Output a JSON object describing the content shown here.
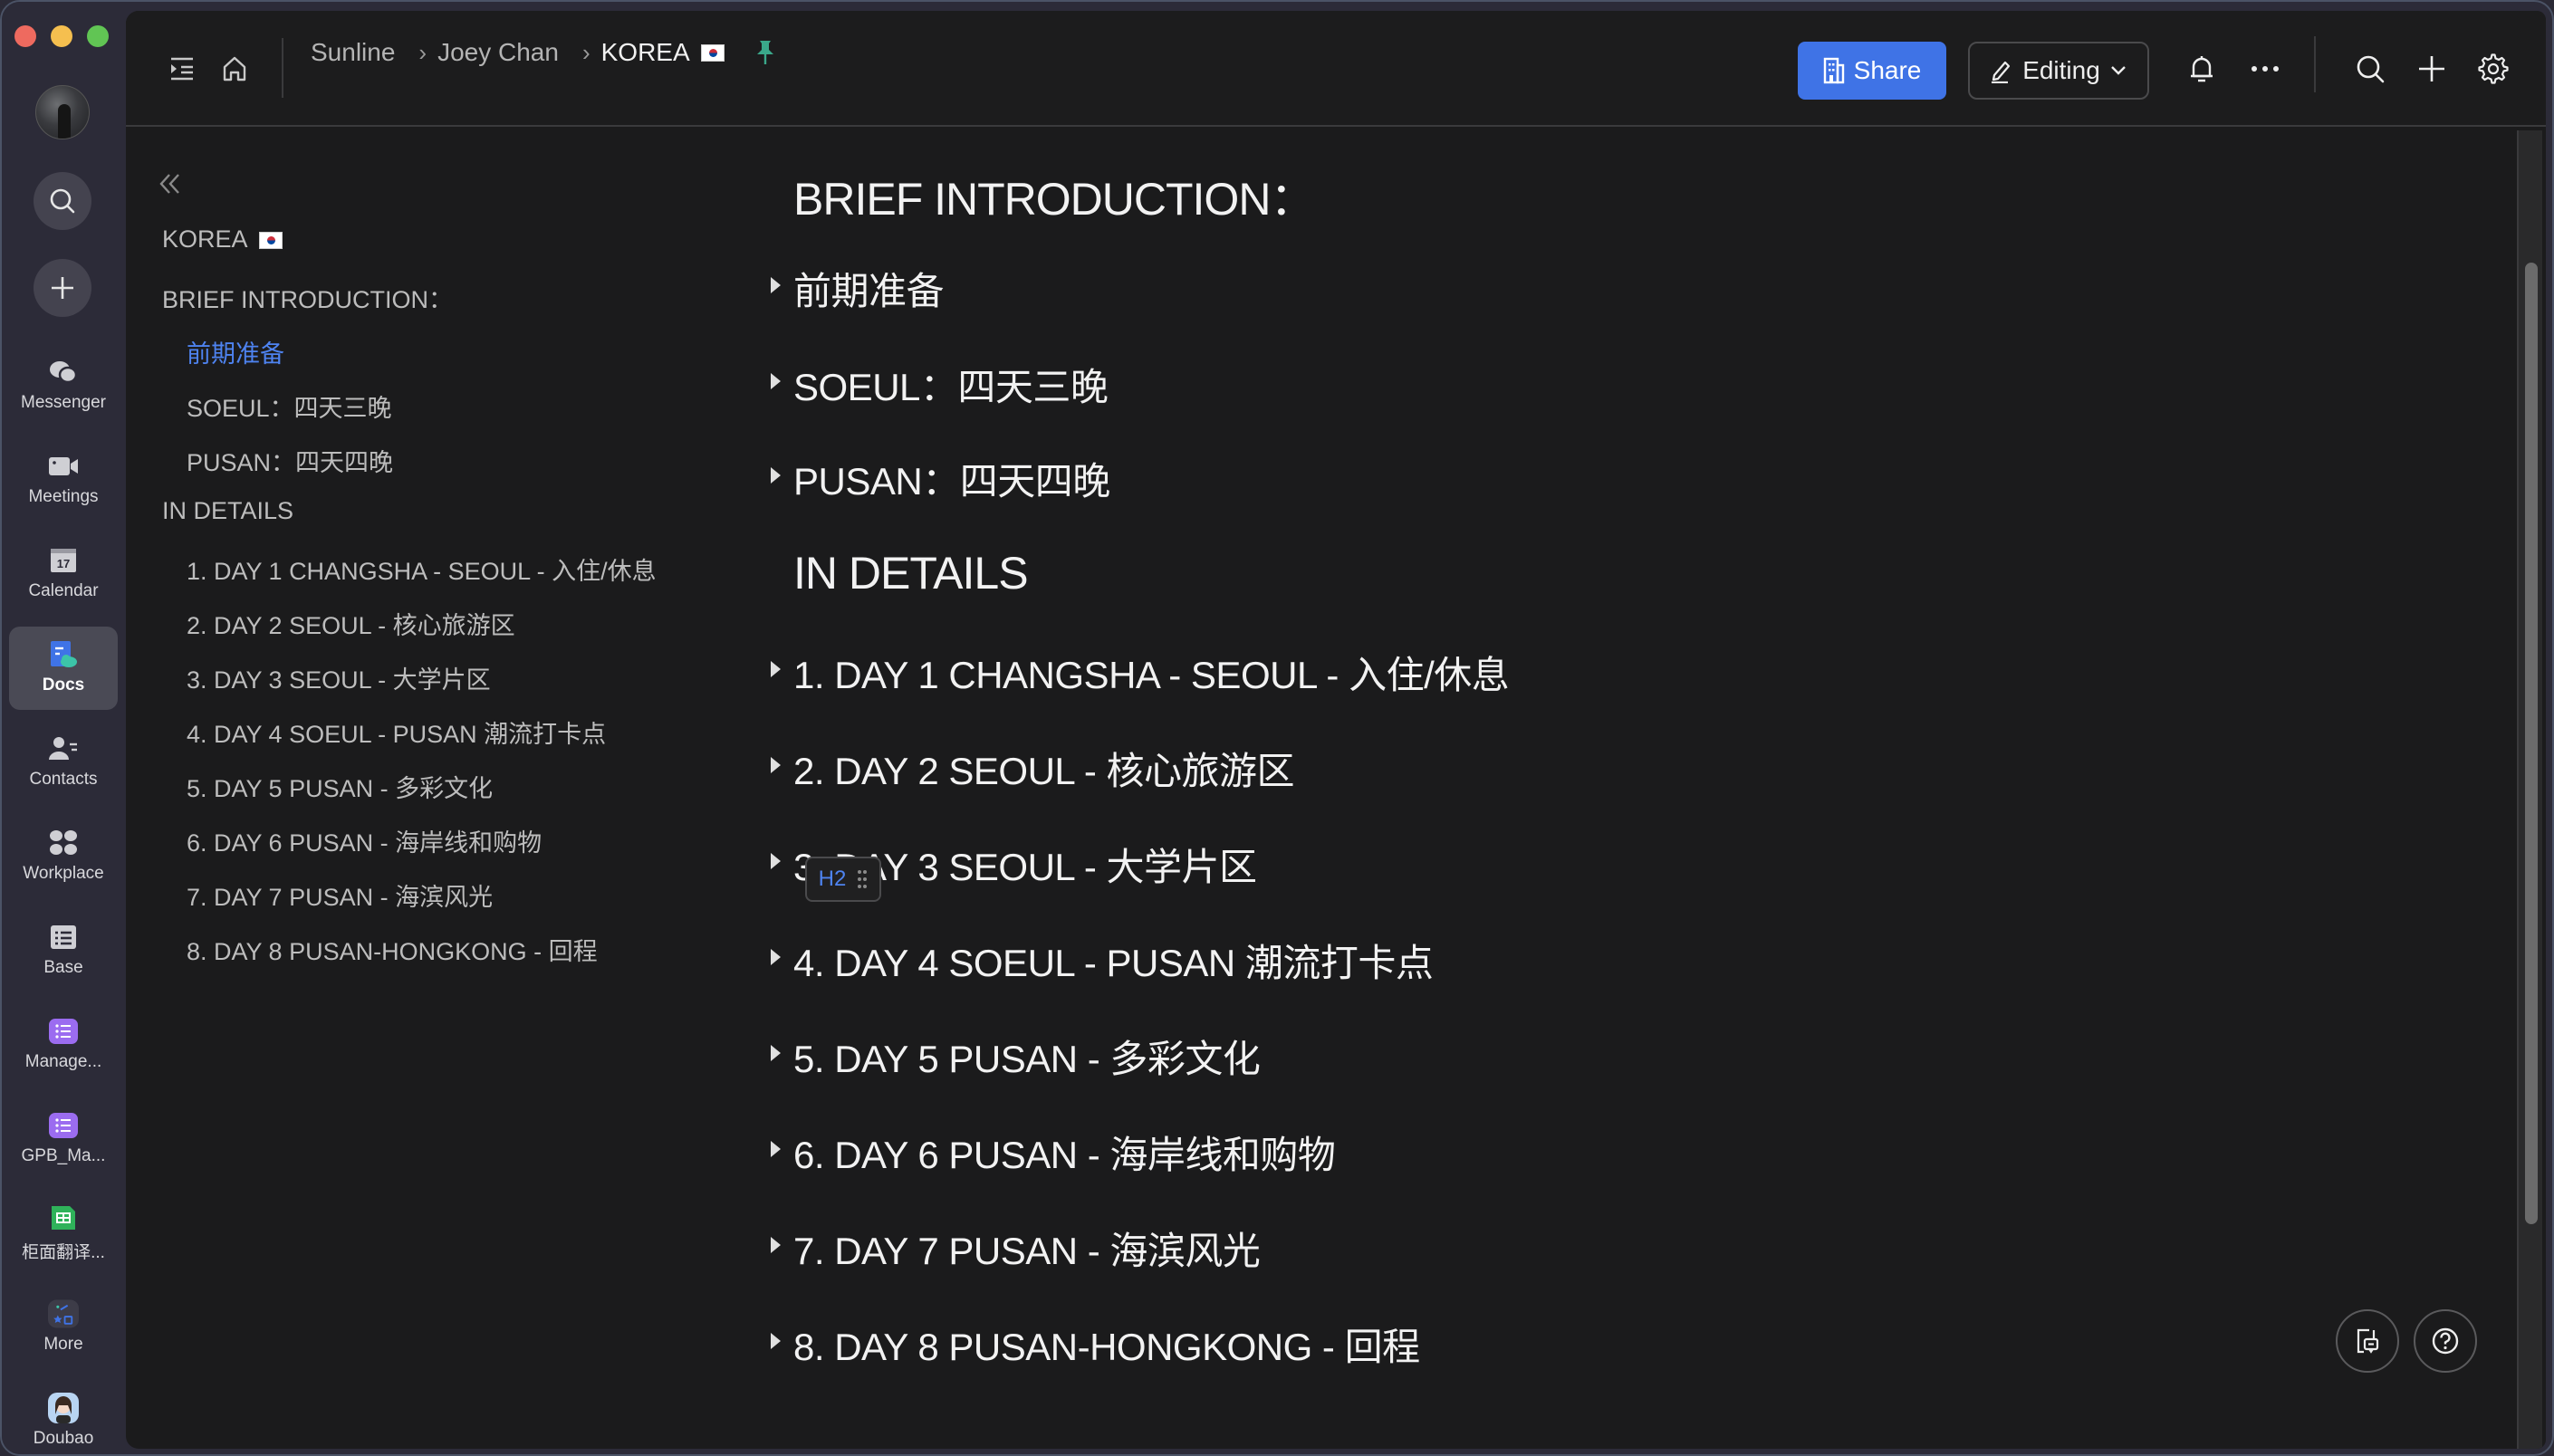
{
  "window": {
    "traffic_lights": [
      "close",
      "minimize",
      "maximize"
    ]
  },
  "rail": {
    "avatar_alt": "user-avatar",
    "search_icon": "search-icon",
    "add_icon": "plus-icon",
    "items": [
      {
        "label": "Messenger",
        "icon": "chat-bubbles-icon",
        "active": false
      },
      {
        "label": "Meetings",
        "icon": "video-camera-icon",
        "active": false
      },
      {
        "label": "Calendar",
        "icon": "calendar-icon",
        "active": false,
        "icon_text": "17"
      },
      {
        "label": "Docs",
        "icon": "docs-icon",
        "active": true
      },
      {
        "label": "Contacts",
        "icon": "contacts-icon",
        "active": false
      },
      {
        "label": "Workplace",
        "icon": "grid-icon",
        "active": false
      },
      {
        "label": "Base",
        "icon": "table-icon",
        "active": false
      },
      {
        "label": "Manage...",
        "icon": "list-app-icon",
        "active": false
      },
      {
        "label": "GPB_Ma...",
        "icon": "list-app-icon",
        "active": false
      },
      {
        "label": "柜面翻译...",
        "icon": "sheet-icon",
        "active": false
      },
      {
        "label": "More",
        "icon": "more-apps-icon",
        "active": false
      },
      {
        "label": "Doubao",
        "icon": "doubao-avatar-icon",
        "active": false
      }
    ]
  },
  "header": {
    "breadcrumb": [
      "Sunline",
      "Joey Chan",
      "KOREA"
    ],
    "breadcrumb_sep": "›",
    "share_label": "Share",
    "editing_label": "Editing",
    "colors": {
      "share_bg": "#3f73e6",
      "pin": "#3aa88a"
    }
  },
  "outline": {
    "items": [
      {
        "label": "KOREA",
        "level": 1,
        "flag": true,
        "active": false
      },
      {
        "label": "BRIEF INTRODUCTION：",
        "level": 1,
        "active": false
      },
      {
        "label": "前期准备",
        "level": 2,
        "active": true
      },
      {
        "label": "SOEUL：四天三晚",
        "level": 2,
        "active": false
      },
      {
        "label": "PUSAN：四天四晚",
        "level": 2,
        "active": false
      },
      {
        "label": "IN DETAILS",
        "level": 1,
        "active": false
      },
      {
        "label": "1. DAY 1 CHANGSHA - SEOUL - 入住/休息",
        "level": 2,
        "active": false
      },
      {
        "label": "2. DAY 2 SEOUL - 核心旅游区",
        "level": 2,
        "active": false
      },
      {
        "label": "3. DAY 3 SEOUL - 大学片区",
        "level": 2,
        "active": false
      },
      {
        "label": "4. DAY 4 SOEUL - PUSAN 潮流打卡点",
        "level": 2,
        "active": false
      },
      {
        "label": "5. DAY 5 PUSAN - 多彩文化",
        "level": 2,
        "active": false
      },
      {
        "label": "6. DAY 6 PUSAN - 海岸线和购物",
        "level": 2,
        "active": false
      },
      {
        "label": "7. DAY 7 PUSAN - 海滨风光",
        "level": 2,
        "active": false
      },
      {
        "label": "8. DAY 8 PUSAN-HONGKONG - 回程",
        "level": 2,
        "active": false
      }
    ],
    "active_color": "#4e83f0"
  },
  "doc": {
    "sections": [
      {
        "type": "h1",
        "text": "BRIEF INTRODUCTION："
      },
      {
        "type": "h2",
        "text": "前期准备"
      },
      {
        "type": "h2",
        "text": "SOEUL：四天三晚"
      },
      {
        "type": "h2",
        "text": "PUSAN：四天四晚"
      },
      {
        "type": "h1",
        "text": "IN DETAILS"
      },
      {
        "type": "h2",
        "text": "1. DAY 1  CHANGSHA - SEOUL - 入住/休息"
      },
      {
        "type": "h2",
        "text": "2. DAY 2 SEOUL - 核心旅游区"
      },
      {
        "type": "h2",
        "text": "3. DAY 3 SEOUL - 大学片区"
      },
      {
        "type": "h2",
        "text": "4. DAY 4 SOEUL - PUSAN 潮流打卡点"
      },
      {
        "type": "h2",
        "text": "5. DAY 5 PUSAN - 多彩文化"
      },
      {
        "type": "h2",
        "text": "6. DAY 6 PUSAN - 海岸线和购物"
      },
      {
        "type": "h2",
        "text": "7. DAY 7 PUSAN - 海滨风光"
      },
      {
        "type": "h2",
        "text": "8. DAY 8 PUSAN-HONGKONG - 回程"
      }
    ],
    "block_handle_label": "H2"
  },
  "scroll": {
    "thumb_start_fraction": 0.1,
    "thumb_size_fraction": 0.73
  },
  "fabs": [
    {
      "name": "doc-comments-button",
      "icon": "doc-comment-icon"
    },
    {
      "name": "help-button",
      "icon": "help-icon"
    }
  ]
}
